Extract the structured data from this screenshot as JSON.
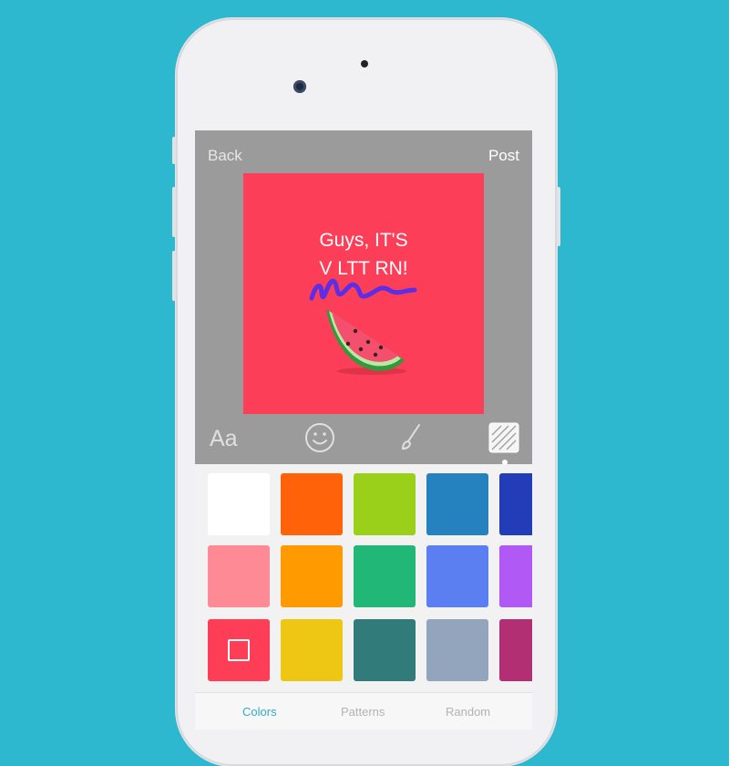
{
  "nav": {
    "back_label": "Back",
    "post_label": "Post"
  },
  "card": {
    "text_line1": "Guys, IT'S",
    "text_line2": "V LTT RN!",
    "background_color": "#fd3e58",
    "scribble_color": "#5c2ee6"
  },
  "toolbar": {
    "text_tool_label": "Aa",
    "tools": [
      "text-icon",
      "emoji-smiley-icon",
      "brush-icon",
      "background-pattern-icon"
    ],
    "selected_tool": "background-pattern-icon"
  },
  "palette": {
    "colors": [
      [
        "#ffffff",
        "#ff6208",
        "#9ad019",
        "#2582bf",
        "#233db8"
      ],
      [
        "#fe8a95",
        "#ff9a01",
        "#20b777",
        "#5b7ff1",
        "#b159f4"
      ],
      [
        "#fe3e57",
        "#edc713",
        "#317b7b",
        "#93a4bd",
        "#b22f74"
      ]
    ],
    "selected": "#fe3e57"
  },
  "tabs": [
    {
      "label": "Colors",
      "active": true
    },
    {
      "label": "Patterns",
      "active": false
    },
    {
      "label": "Random",
      "active": false
    }
  ]
}
